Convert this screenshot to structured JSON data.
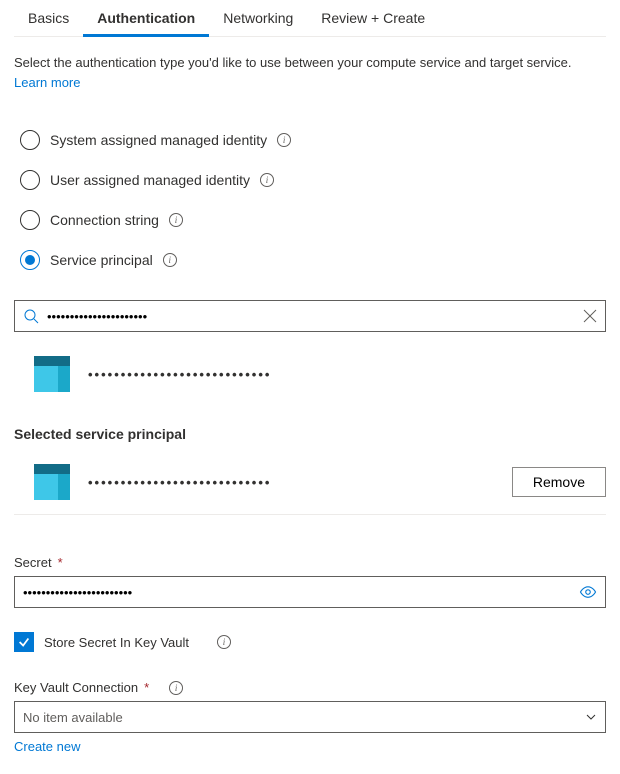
{
  "tabs": {
    "basics": "Basics",
    "authentication": "Authentication",
    "networking": "Networking",
    "review": "Review + Create"
  },
  "description": {
    "text": "Select the authentication type you'd like to use between your compute service and target service. ",
    "learn_more": "Learn more"
  },
  "auth_options": {
    "system_identity": "System assigned managed identity",
    "user_identity": "User assigned managed identity",
    "connection_string": "Connection string",
    "service_principal": "Service principal"
  },
  "search": {
    "value": "••••••••••••••••••••••"
  },
  "result": {
    "name": "••••••••••••••••••••••••••••"
  },
  "selected_section_title": "Selected service principal",
  "selected": {
    "name": "••••••••••••••••••••••••••••",
    "remove": "Remove"
  },
  "secret": {
    "label": "Secret",
    "value": "••••••••••••••••••••••••"
  },
  "store_kv_label": "Store Secret In Key Vault",
  "kv": {
    "label": "Key Vault Connection",
    "placeholder": "No item available",
    "create_new": "Create new"
  }
}
